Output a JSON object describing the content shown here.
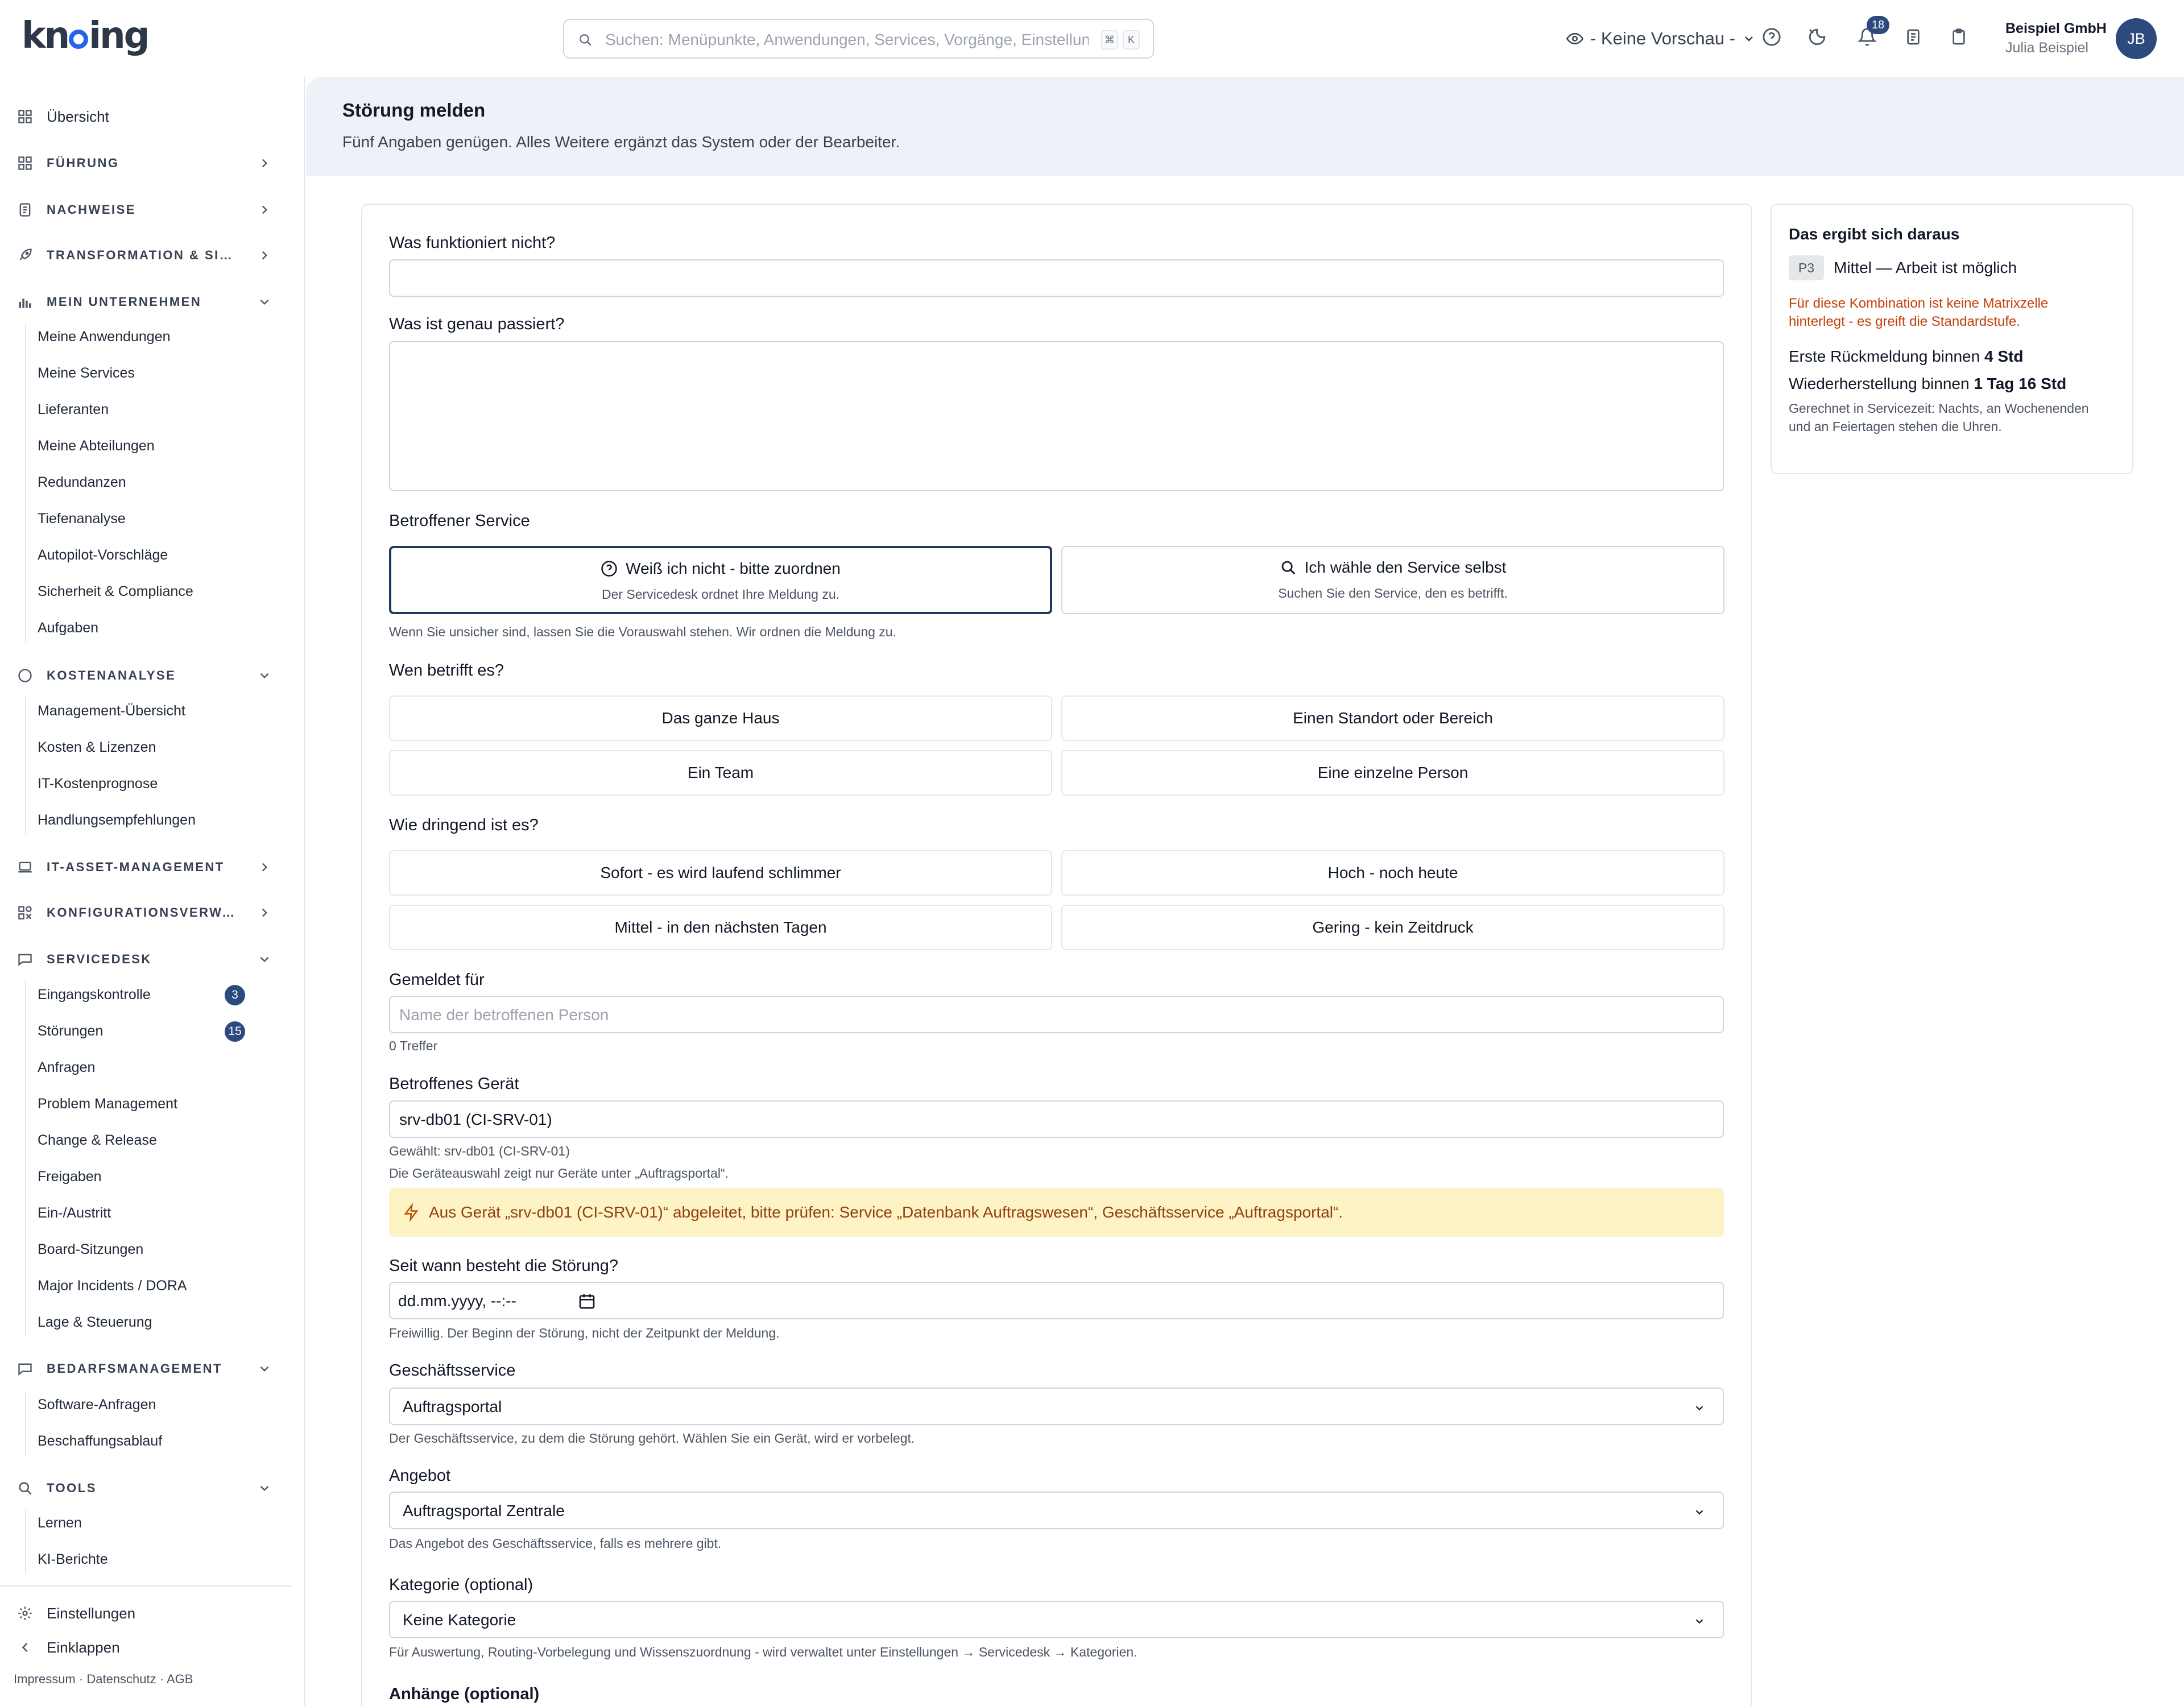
{
  "header": {
    "logo_text": "knoing",
    "search_placeholder": "Suchen: Menüpunkte, Anwendungen, Services, Vorgänge, Einstellungen",
    "search_kbd": [
      "⌘",
      "K"
    ],
    "preview_label": "- Keine Vorschau -",
    "notification_count": "18",
    "org_name": "Beispiel GmbH",
    "user_name": "Julia Beispiel",
    "avatar_initials": "JB"
  },
  "sidebar": {
    "overview": "Übersicht",
    "sections": {
      "fuehrung": "FÜHRUNG",
      "nachweise": "NACHWEISE",
      "transformation": "TRANSFORMATION & SICHERHEIT",
      "mein_unternehmen": "MEIN UNTERNEHMEN",
      "kostenanalyse": "KOSTENANALYSE",
      "it_asset": "IT-ASSET-MANAGEMENT",
      "konfiguration": "KONFIGURATIONSVERWALTUNG",
      "servicedesk": "SERVICEDESK",
      "bedarfsmanagement": "BEDARFSMANAGEMENT",
      "tools": "TOOLS"
    },
    "mein_unternehmen_items": [
      "Meine Anwendungen",
      "Meine Services",
      "Lieferanten",
      "Meine Abteilungen",
      "Redundanzen",
      "Tiefenanalyse",
      "Autopilot-Vorschläge",
      "Sicherheit & Compliance",
      "Aufgaben"
    ],
    "kostenanalyse_items": [
      "Management-Übersicht",
      "Kosten & Lizenzen",
      "IT-Kostenprognose",
      "Handlungsempfehlungen"
    ],
    "servicedesk_items": [
      "Eingangskontrolle",
      "Störungen",
      "Anfragen",
      "Problem Management",
      "Change & Release",
      "Freigaben",
      "Ein-/Austritt",
      "Board-Sitzungen",
      "Major Incidents / DORA",
      "Lage & Steuerung"
    ],
    "servicedesk_badges": {
      "eingangskontrolle": "3",
      "stoerungen": "15"
    },
    "bedarf_items": [
      "Software-Anfragen",
      "Beschaffungsablauf"
    ],
    "tools_items": [
      "Lernen",
      "KI-Berichte"
    ],
    "settings": "Einstellungen",
    "collapse": "Einklappen",
    "footer_links": "Impressum  ·  Datenschutz  ·  AGB"
  },
  "page": {
    "title": "Störung melden",
    "subtitle": "Fünf Angaben genügen. Alles Weitere ergänzt das System oder der Bearbeiter."
  },
  "form": {
    "what_label": "Was funktioniert nicht?",
    "what_value": "",
    "detail_label": "Was ist genau passiert?",
    "detail_value": "",
    "service_label": "Betroffener Service",
    "service_options": [
      {
        "title": "Weiß ich nicht - bitte zuordnen",
        "desc": "Der Servicedesk ordnet Ihre Meldung zu."
      },
      {
        "title": "Ich wähle den Service selbst",
        "desc": "Suchen Sie den Service, den es betrifft."
      }
    ],
    "service_help": "Wenn Sie unsicher sind, lassen Sie die Vorauswahl stehen. Wir ordnen die Meldung zu.",
    "scope_label": "Wen betrifft es?",
    "scope_options": [
      "Das ganze Haus",
      "Einen Standort oder Bereich",
      "Ein Team",
      "Eine einzelne Person"
    ],
    "urgency_label": "Wie dringend ist es?",
    "urgency_options": [
      "Sofort - es wird laufend schlimmer",
      "Hoch - noch heute",
      "Mittel - in den nächsten Tagen",
      "Gering - kein Zeitdruck"
    ],
    "reported_for_label": "Gemeldet für",
    "reported_for_placeholder": "Name der betroffenen Person",
    "reported_for_hits": "0 Treffer",
    "device_label": "Betroffenes Gerät",
    "device_value": "srv-db01 (CI-SRV-01)",
    "device_selected": "Gewählt: srv-db01 (CI-SRV-01)",
    "device_help": "Die Geräteauswahl zeigt nur Geräte unter „Auftragsportal“.",
    "device_warning": "Aus Gerät „srv-db01 (CI-SRV-01)“ abgeleitet, bitte prüfen: Service „Datenbank Auftragswesen“, Geschäftsservice „Auftragsportal“.",
    "since_label": "Seit wann besteht die Störung?",
    "since_placeholder": "dd.mm.yyyy, --:--",
    "since_help": "Freiwillig. Der Beginn der Störung, nicht der Zeitpunkt der Meldung.",
    "business_label": "Geschäftsservice",
    "business_value": "Auftragsportal",
    "business_help": "Der Geschäftsservice, zu dem die Störung gehört. Wählen Sie ein Gerät, wird er vorbelegt.",
    "offer_label": "Angebot",
    "offer_value": "Auftragsportal Zentrale",
    "offer_help": "Das Angebot des Geschäftsservice, falls es mehrere gibt.",
    "category_label": "Kategorie (optional)",
    "category_value": "Keine Kategorie",
    "category_help": "Für Auswertung, Routing-Vorbelegung und Wissenszuordnung - wird verwaltet unter Einstellungen → Servicedesk → Kategorien.",
    "attachments_label": "Anhänge (optional)"
  },
  "result": {
    "title": "Das ergibt sich daraus",
    "priority_badge": "P3",
    "priority_text": "Mittel — Arbeit ist möglich",
    "matrix_warning": "Für diese Kombination ist keine Matrixzelle hinterlegt - es greift die Standardstufe.",
    "first_response_label": "Erste Rückmeldung binnen",
    "first_response_value": "4 Std",
    "restore_label": "Wiederherstellung binnen",
    "restore_value": "1 Tag 16 Std",
    "note": "Gerechnet in Servicezeit: Nachts, an Wochenenden und an Feiertagen stehen die Uhren."
  }
}
